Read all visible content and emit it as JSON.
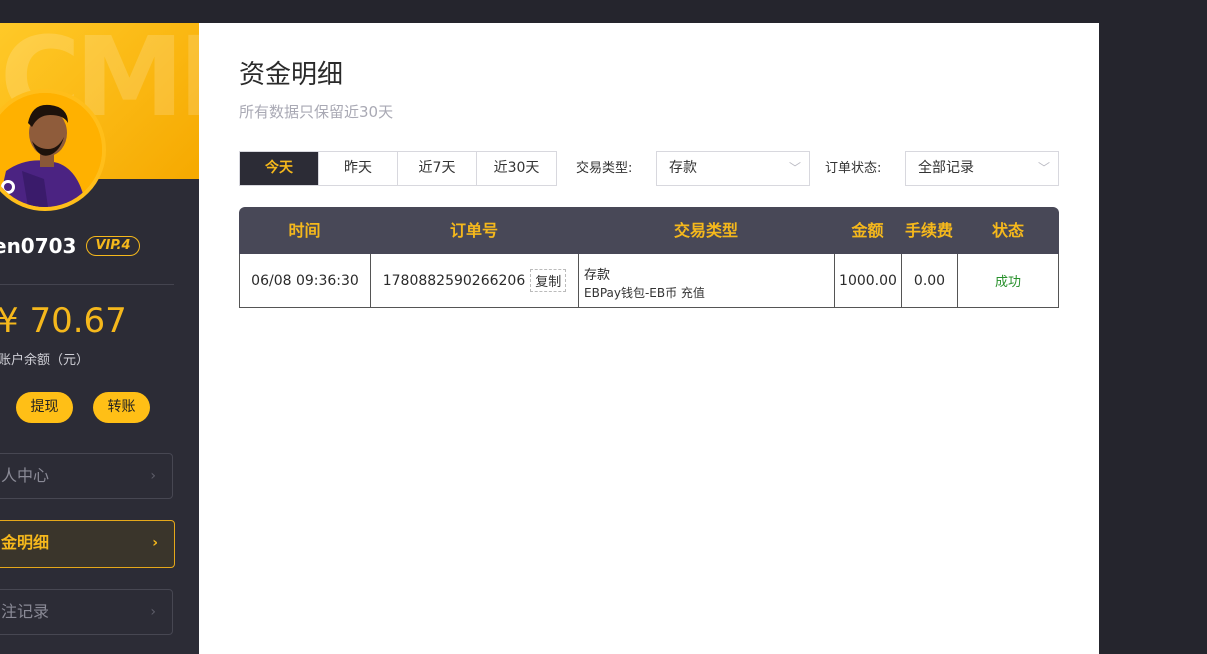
{
  "sidebar": {
    "watermark": "CMF",
    "username": "en0703",
    "vip": "VIP.4",
    "balance": "¥ 70.67",
    "balance_label": "账户余额（元）",
    "withdraw_label": "提现",
    "transfer_label": "转账",
    "nav": [
      {
        "label": "个人中心",
        "active": false
      },
      {
        "label": "资金明细",
        "active": true
      },
      {
        "label": "投注记录",
        "active": false
      }
    ],
    "nav_visible": [
      "人中心",
      "金明细",
      "注记录"
    ],
    "chevron": "›"
  },
  "main": {
    "title": "资金明细",
    "subtitle": "所有数据只保留近30天",
    "tabs": [
      "今天",
      "昨天",
      "近7天",
      "近30天"
    ],
    "active_tab": 0,
    "type_filter_label": "交易类型:",
    "type_filter_value": "存款",
    "status_filter_label": "订单状态:",
    "status_filter_value": "全部记录",
    "caret": "﹀"
  },
  "table": {
    "columns": [
      "时间",
      "订单号",
      "交易类型",
      "金额",
      "手续费",
      "状态"
    ],
    "rows": [
      {
        "time": "06/08 09:36:30",
        "order_no": "1780882590266206",
        "copy_label": "复制",
        "type_main": "存款",
        "type_sub": "EBPay钱包-EB币 充值",
        "amount": "1000.00",
        "fee": "0.00",
        "status": "成功"
      }
    ]
  },
  "colors": {
    "accent": "#f5b81c",
    "sidebar_bg": "#2c2c36",
    "table_header_bg": "#484857",
    "success": "#27902b"
  },
  "icons": [
    "chevron-right-icon",
    "caret-down-icon",
    "avatar"
  ]
}
